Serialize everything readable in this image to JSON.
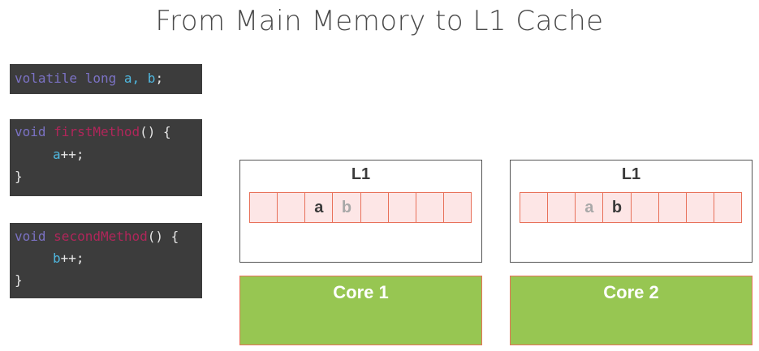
{
  "title": "From Main Memory to L1 Cache",
  "code": {
    "declaration": {
      "keyword1": "volatile",
      "keyword2": "long",
      "var_a": "a",
      "comma": ",",
      "var_b": "b",
      "semicolon": ";"
    },
    "first_method": {
      "return_type": "void",
      "name": "firstMethod",
      "signature_tail": "() {",
      "body_var": "a",
      "body_op": "++;",
      "closing": "}"
    },
    "second_method": {
      "return_type": "void",
      "name": "secondMethod",
      "signature_tail": "() {",
      "body_var": "b",
      "body_op": "++;",
      "closing": "}"
    }
  },
  "caches": [
    {
      "label": "L1",
      "cells": [
        "",
        "",
        "a",
        "b",
        "",
        "",
        "",
        ""
      ],
      "active_cell": 2
    },
    {
      "label": "L1",
      "cells": [
        "",
        "",
        "a",
        "b",
        "",
        "",
        "",
        ""
      ],
      "active_cell": 3
    }
  ],
  "cores": [
    {
      "label": "Core 1"
    },
    {
      "label": "Core 2"
    }
  ],
  "colors": {
    "core_fill": "#97c652",
    "cache_cell_fill": "#fde6e6",
    "cache_cell_border": "#e8715a",
    "code_background": "#3c3c3c",
    "keyword": "#7b72c4",
    "method_name": "#b0265a",
    "variable": "#4fb8e0"
  }
}
